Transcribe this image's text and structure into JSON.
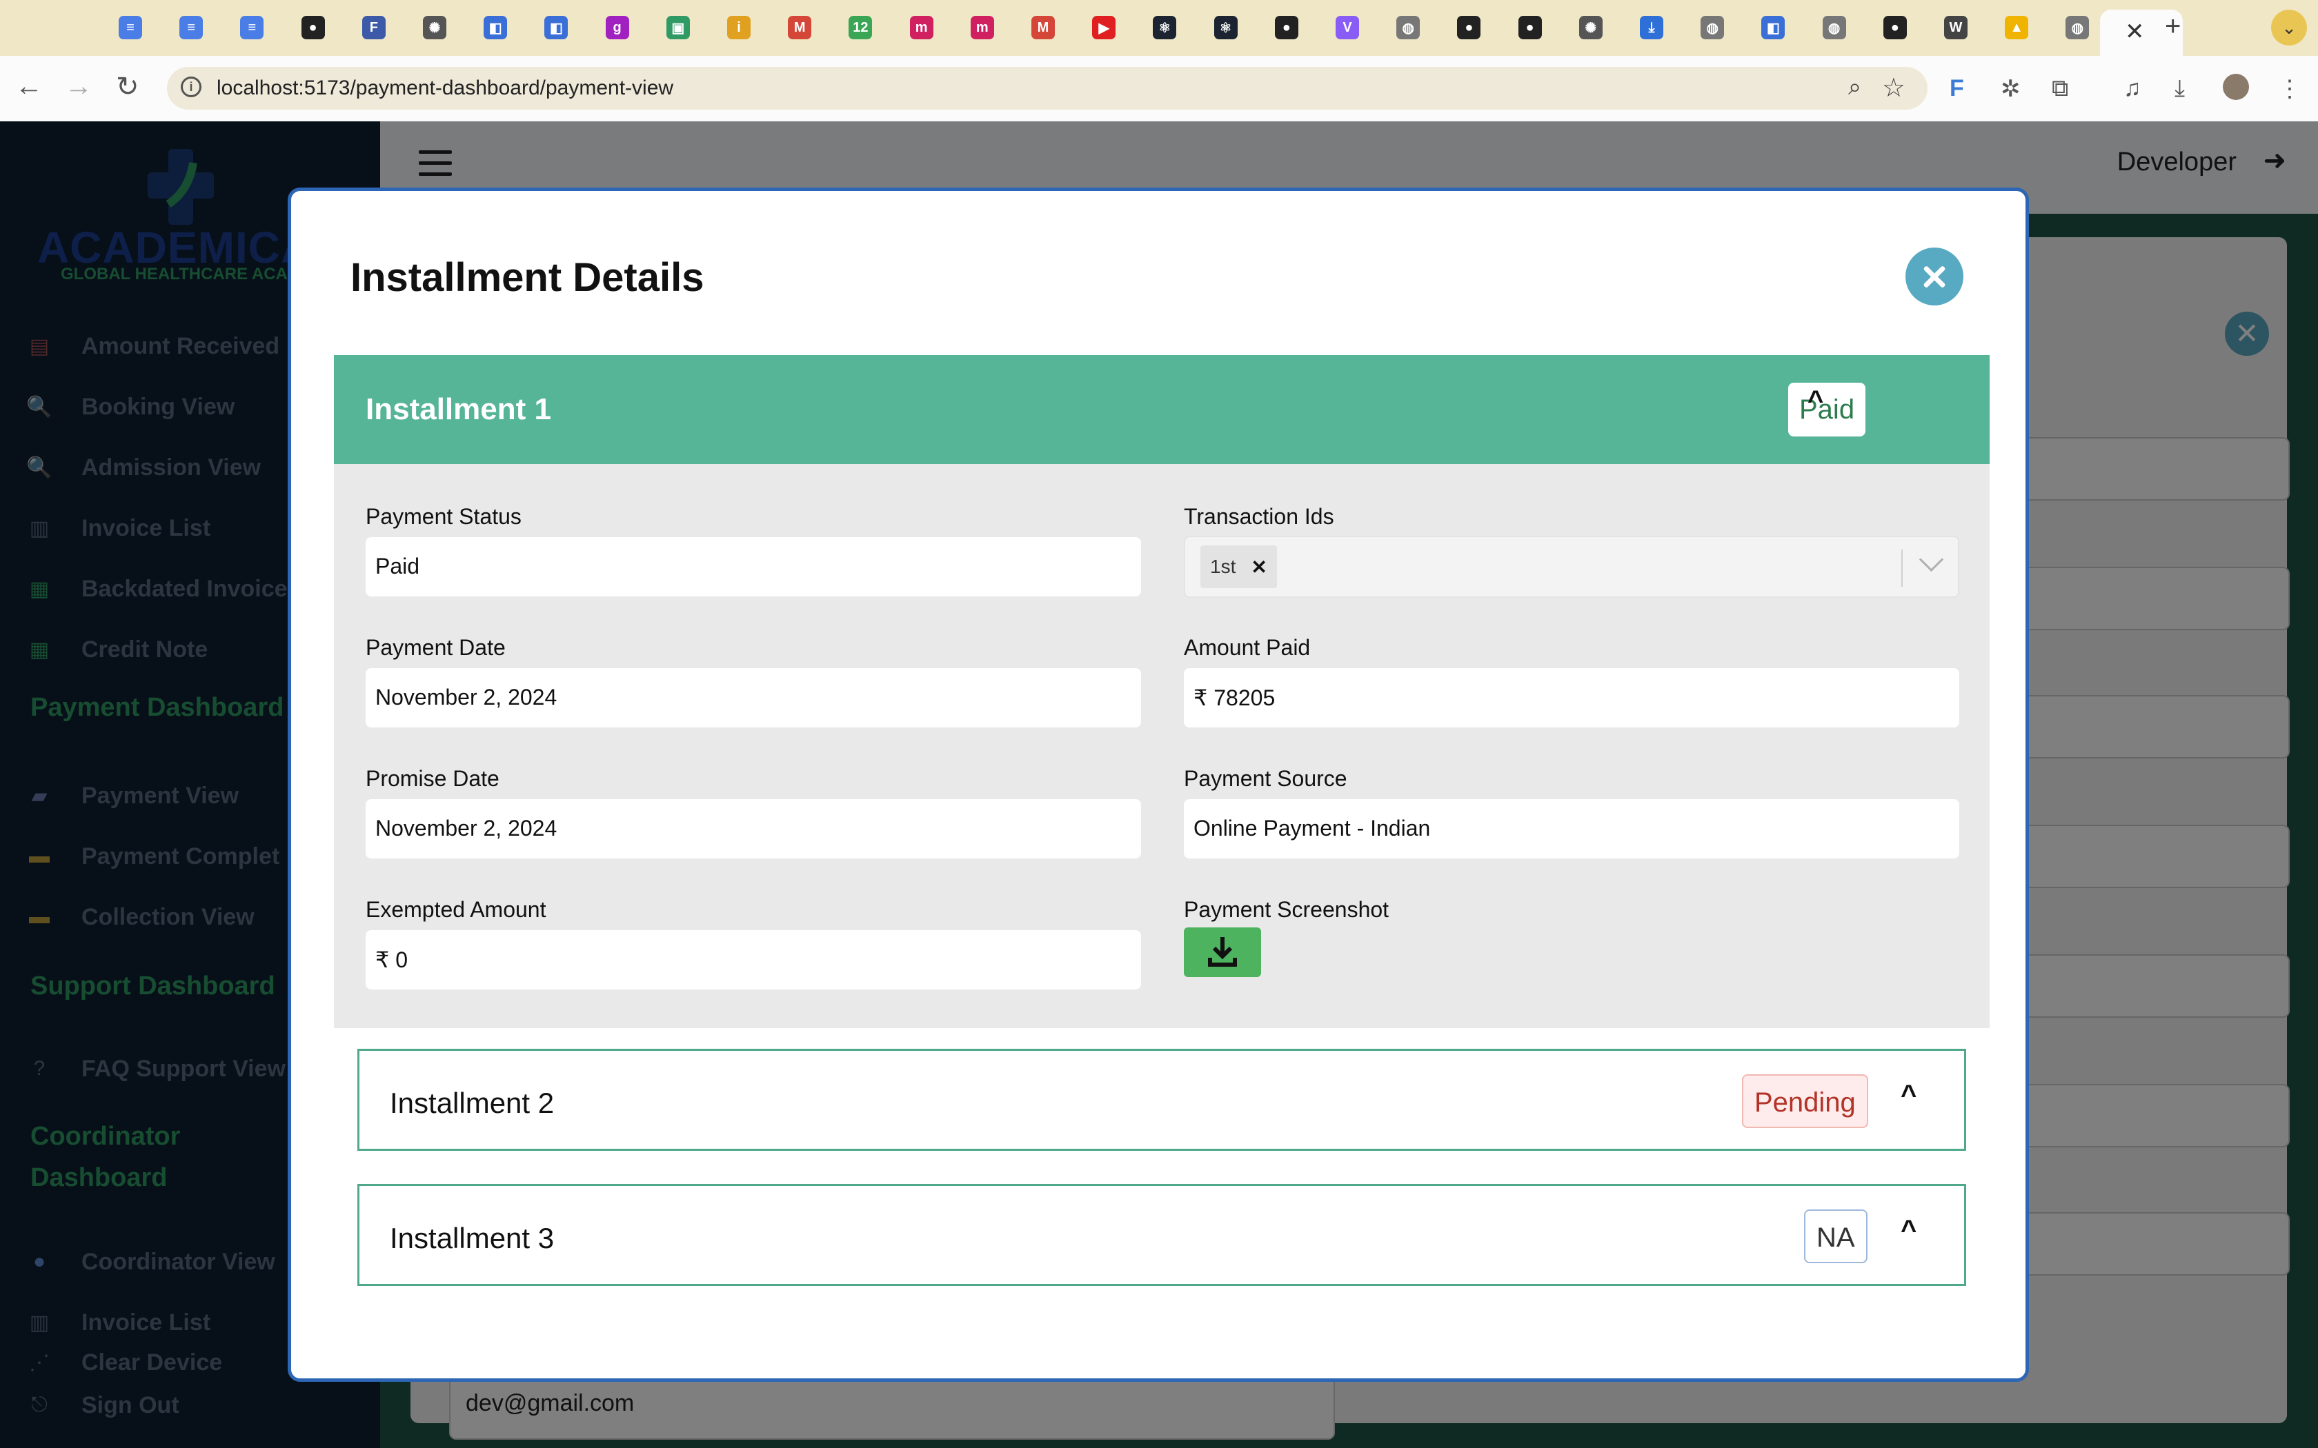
{
  "browser": {
    "url": "localhost:5173/payment-dashboard/payment-view",
    "tab_icons": [
      "docs-icon",
      "docs-icon",
      "docs-icon",
      "github-icon",
      "frt-icon",
      "openai-icon",
      "app-icon",
      "app-icon",
      "g-icon",
      "chat-icon",
      "i-icon",
      "gmail-icon",
      "twelve-icon",
      "m-icon",
      "m-icon",
      "gmail-icon",
      "youtube-icon",
      "react-icon",
      "react-icon",
      "github-icon",
      "vite-icon",
      "globe-icon",
      "github-icon",
      "github-icon",
      "openai-icon",
      "download-icon",
      "globe-icon",
      "app-icon",
      "globe-icon",
      "github-icon",
      "wikipedia-icon",
      "drive-icon",
      "globe-icon"
    ]
  },
  "app": {
    "logo_text": "ACADEMICALL",
    "logo_subtitle": "GLOBAL HEALTHCARE ACADEMY",
    "sidebar": {
      "items_top": [
        {
          "label": "Amount Received",
          "icon": "receipt-icon"
        },
        {
          "label": "Booking View",
          "icon": "doc-search-icon"
        },
        {
          "label": "Admission View",
          "icon": "doc-search-icon"
        },
        {
          "label": "Invoice List",
          "icon": "invoice-icon"
        },
        {
          "label": "Backdated Invoice",
          "icon": "green-doc-icon"
        },
        {
          "label": "Credit Note",
          "icon": "green-doc-icon"
        }
      ],
      "payment_heading": "Payment Dashboard",
      "payment_items": [
        {
          "label": "Payment View",
          "icon": "payment-icon"
        },
        {
          "label": "Payment Complet",
          "icon": "cards-icon"
        },
        {
          "label": "Collection View",
          "icon": "cards-icon"
        }
      ],
      "support_heading": "Support Dashboard",
      "support_items": [
        {
          "label": "FAQ Support View",
          "icon": "faq-icon"
        }
      ],
      "coordinator_heading_1": "Coordinator",
      "coordinator_heading_2": "Dashboard",
      "coordinator_items": [
        {
          "label": "Coordinator View",
          "icon": "user-icon"
        },
        {
          "label": "Invoice List",
          "icon": "invoice-icon"
        },
        {
          "label": "Clear Device",
          "icon": "chart-icon"
        }
      ],
      "sign_out": "Sign Out"
    },
    "header": {
      "user": "Developer"
    },
    "background_email": "dev@gmail.com"
  },
  "modal": {
    "title": "Installment Details",
    "installments": [
      {
        "title": "Installment 1",
        "status": "Paid",
        "expanded": true,
        "fields": {
          "payment_status_label": "Payment Status",
          "payment_status": "Paid",
          "transaction_ids_label": "Transaction Ids",
          "transaction_ids": [
            "1st"
          ],
          "payment_date_label": "Payment Date",
          "payment_date": "November 2, 2024",
          "amount_paid_label": "Amount Paid",
          "amount_paid": "₹ 78205",
          "promise_date_label": "Promise Date",
          "promise_date": "November 2, 2024",
          "payment_source_label": "Payment Source",
          "payment_source": "Online Payment - Indian",
          "exempted_amount_label": "Exempted Amount",
          "exempted_amount": "₹ 0",
          "payment_screenshot_label": "Payment Screenshot"
        }
      },
      {
        "title": "Installment 2",
        "status": "Pending",
        "expanded": false
      },
      {
        "title": "Installment 3",
        "status": "NA",
        "expanded": false
      }
    ],
    "chevron": "^"
  },
  "colors": {
    "accent_green": "#56b596",
    "sidebar_bg": "#0f2033",
    "modal_border": "#2d66b4",
    "close_button": "#58a9c2",
    "download_button": "#4db35f",
    "pending": "#b33328"
  }
}
